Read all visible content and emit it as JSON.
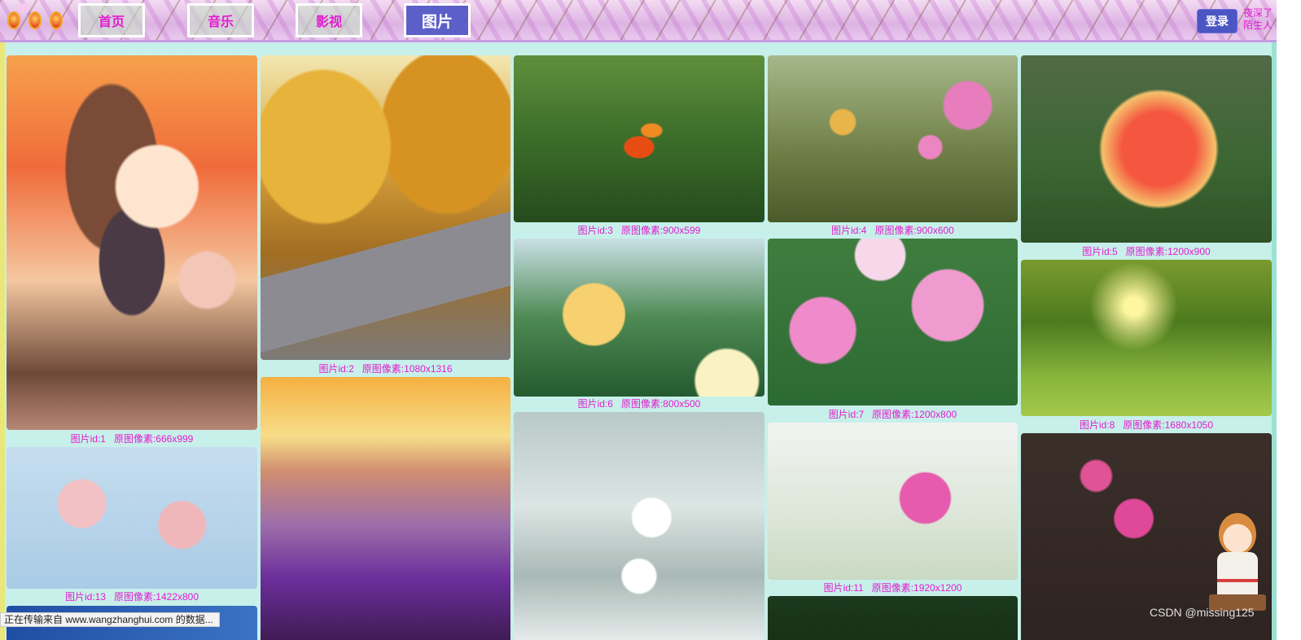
{
  "nav": {
    "items": [
      {
        "label": "首页"
      },
      {
        "label": "音乐"
      },
      {
        "label": "影视"
      },
      {
        "label": "图片"
      }
    ],
    "active_index": 3
  },
  "header": {
    "login_label": "登录",
    "user_text": "夜深了陌生人"
  },
  "gallery": {
    "captions": [
      "图片id:1   原图像素:666x999",
      "图片id:2   原图像素:1080x1316",
      "图片id:3   原图像素:900x599",
      "图片id:4   原图像素:900x600",
      "图片id:5   原图像素:1200x900",
      "图片id:6   原图像素:800x500",
      "图片id:7   原图像素:1200x800",
      "图片id:8   原图像素:1680x1050",
      "图片id:11   原图像素:1920x1200",
      "图片id:13   原图像素:1422x800"
    ]
  },
  "status_bar": {
    "text": "正在传输来自 www.wangzhanghui.com 的数据..."
  },
  "watermark": {
    "text": "CSDN @missing125"
  },
  "colors": {
    "accent": "#e41bd0",
    "nav_active": "#5b5fc7",
    "login": "#4b55c4",
    "background": "#c7f0ea"
  }
}
